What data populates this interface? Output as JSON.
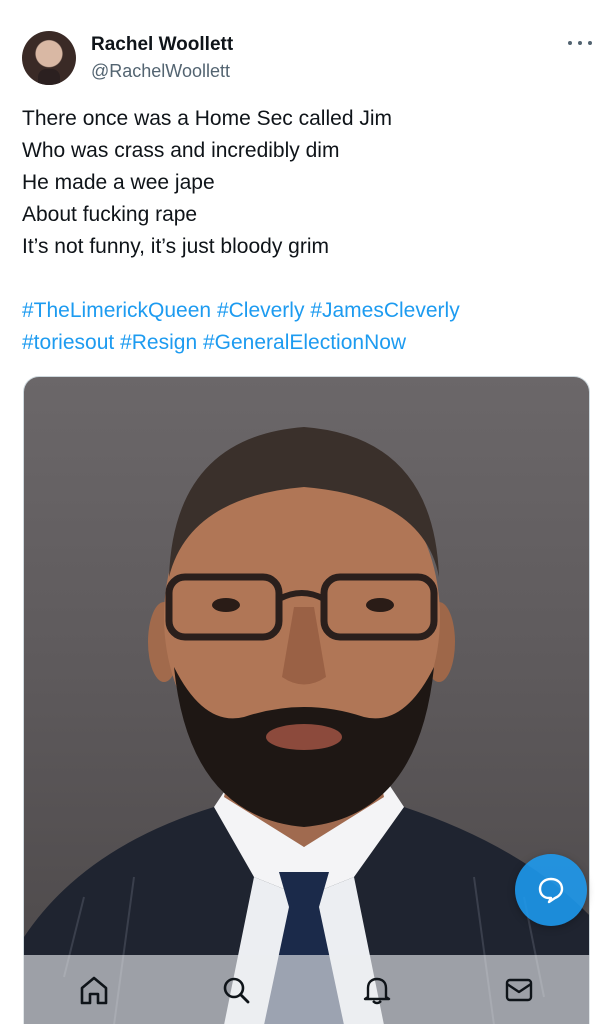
{
  "author": {
    "display_name": "Rachel Woollett",
    "handle": "@RachelWoollett",
    "avatar_icon": "profile-photo"
  },
  "tweet": {
    "lines": [
      "There once was a Home Sec called Jim",
      "Who was crass and incredibly dim",
      "He made a wee jape",
      "About fucking rape",
      "It’s not funny, it’s just bloody grim"
    ],
    "hashtags_line1": [
      "#TheLimerickQueen",
      "#Cleverly",
      "#JamesCleverly"
    ],
    "hashtags_line2": [
      "#toriesout",
      "#Resign",
      "#GeneralElectionNow"
    ]
  },
  "media": {
    "description_icon": "photo-portrait"
  },
  "colors": {
    "accent": "#1d9bf0",
    "text": "#0f1419",
    "secondary": "#536471"
  },
  "nav": {
    "items": [
      "home-icon",
      "search-icon",
      "notifications-icon",
      "messages-icon"
    ]
  }
}
